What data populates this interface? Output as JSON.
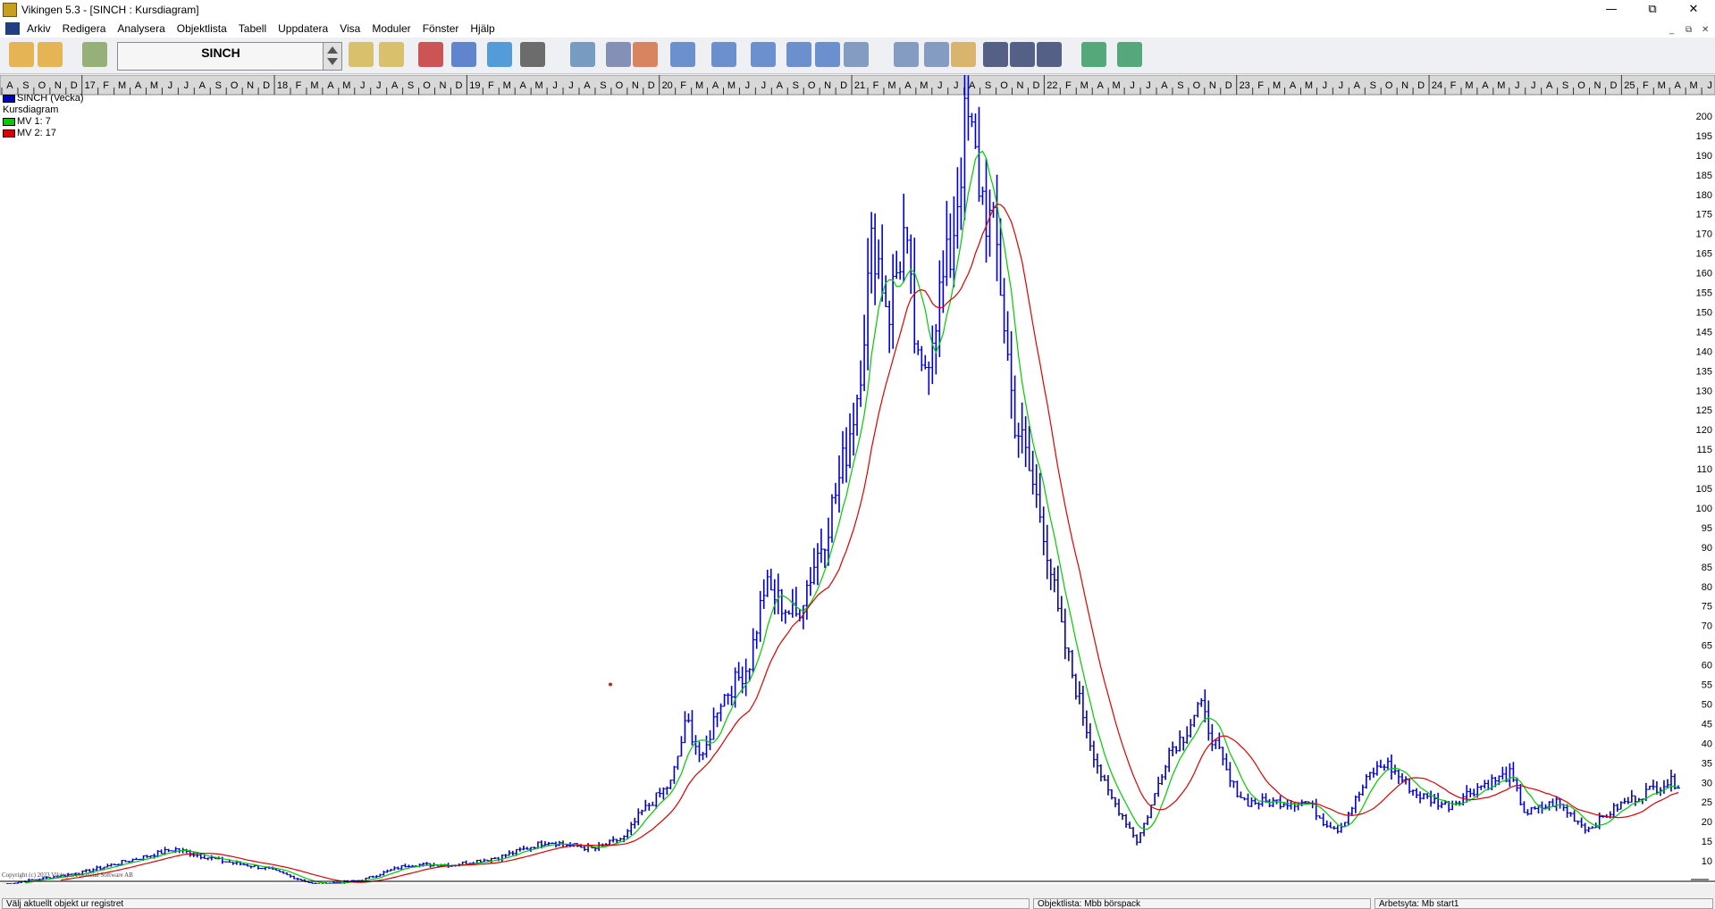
{
  "window": {
    "title": "Vikingen 5.3 - [SINCH : Kursdiagram]",
    "minimize": "—",
    "maximize": "⧉",
    "close": "✕"
  },
  "menu": [
    "Arkiv",
    "Redigera",
    "Analysera",
    "Objektlista",
    "Tabell",
    "Uppdatera",
    "Visa",
    "Moduler",
    "Fönster",
    "Hjälp"
  ],
  "mdi_controls": {
    "minimize": "_",
    "restore": "⧉",
    "close": "✕"
  },
  "toolbar": {
    "symbol": "SINCH",
    "buttons": [
      "open-icon",
      "export-icon",
      "list-icon",
      "edit-list-icon",
      "chart-edit-icon",
      "candles-icon",
      "info-icon",
      "refresh-icon",
      "camera-icon",
      "print-setup-icon",
      "print-icon",
      "palette-icon",
      "window-close-icon",
      "window-back-icon",
      "window-forward-icon",
      "window-stack-icon",
      "window-grid-icon",
      "calendar-day-icon",
      "calendar-week-icon",
      "calendar-month-icon",
      "calendar-edit-icon",
      "candlestick-icon",
      "bars-icon",
      "line-icon",
      "globe-icon",
      "truck-icon"
    ]
  },
  "colors": {
    "accent": "#0000cc",
    "ma1": "#00cc00",
    "ma2": "#dd0000",
    "status_dot": "#cc2020"
  },
  "legend": [
    {
      "label": "SINCH (Vecka)",
      "color": "#0000cc"
    },
    {
      "label": "Kursdiagram",
      "color": ""
    },
    {
      "label": "MV 1: 7",
      "color": "#00cc00"
    },
    {
      "label": "MV 2: 17",
      "color": "#dd0000"
    }
  ],
  "time_axis": {
    "months": [
      "J",
      "F",
      "M",
      "A",
      "M",
      "J",
      "J",
      "A",
      "S",
      "O",
      "N",
      "D"
    ],
    "year_labels": [
      "17",
      "18",
      "19",
      "20",
      "21",
      "22",
      "23",
      "24",
      "25"
    ]
  },
  "chart_data": {
    "type": "ohlc",
    "title": "SINCH (Vecka)",
    "xlabel": "",
    "ylabel": "",
    "x_start": "2016-08",
    "x_end": "2025-07",
    "ylim": [
      5,
      205
    ],
    "y_ticks": [
      10,
      15,
      20,
      25,
      30,
      35,
      40,
      45,
      50,
      55,
      60,
      65,
      70,
      75,
      80,
      85,
      90,
      95,
      100,
      105,
      110,
      115,
      120,
      125,
      130,
      135,
      140,
      145,
      150,
      155,
      160,
      165,
      170,
      175,
      180,
      185,
      190,
      195,
      200
    ],
    "price_anchors": [
      [
        "2016-08",
        4
      ],
      [
        "2017-01",
        7
      ],
      [
        "2017-04",
        10
      ],
      [
        "2017-07",
        13
      ],
      [
        "2017-10",
        10
      ],
      [
        "2018-01",
        8
      ],
      [
        "2018-04",
        4
      ],
      [
        "2018-07",
        5
      ],
      [
        "2018-10",
        9
      ],
      [
        "2019-01",
        9
      ],
      [
        "2019-04",
        11
      ],
      [
        "2019-07",
        15
      ],
      [
        "2019-10",
        13
      ],
      [
        "2019-12",
        16
      ],
      [
        "2020-01",
        22
      ],
      [
        "2020-03",
        30
      ],
      [
        "2020-04",
        46
      ],
      [
        "2020-05",
        35
      ],
      [
        "2020-06",
        50
      ],
      [
        "2020-08",
        60
      ],
      [
        "2020-09",
        80
      ],
      [
        "2020-11",
        72
      ],
      [
        "2021-01",
        95
      ],
      [
        "2021-02",
        110
      ],
      [
        "2021-03",
        130
      ],
      [
        "2021-04",
        170
      ],
      [
        "2021-05",
        150
      ],
      [
        "2021-06",
        170
      ],
      [
        "2021-07",
        130
      ],
      [
        "2021-08",
        150
      ],
      [
        "2021-09",
        165
      ],
      [
        "2021-10",
        200
      ],
      [
        "2021-11",
        180
      ],
      [
        "2021-12",
        165
      ],
      [
        "2022-01",
        125
      ],
      [
        "2022-02",
        110
      ],
      [
        "2022-03",
        95
      ],
      [
        "2022-04",
        70
      ],
      [
        "2022-05",
        55
      ],
      [
        "2022-06",
        40
      ],
      [
        "2022-07",
        28
      ],
      [
        "2022-08",
        22
      ],
      [
        "2022-09",
        15
      ],
      [
        "2022-10",
        25
      ],
      [
        "2022-11",
        38
      ],
      [
        "2022-12",
        42
      ],
      [
        "2023-01",
        50
      ],
      [
        "2023-02",
        40
      ],
      [
        "2023-03",
        30
      ],
      [
        "2023-04",
        25
      ],
      [
        "2023-06",
        25
      ],
      [
        "2023-08",
        25
      ],
      [
        "2023-09",
        20
      ],
      [
        "2023-10",
        18
      ],
      [
        "2023-12",
        32
      ],
      [
        "2024-01",
        35
      ],
      [
        "2024-03",
        27
      ],
      [
        "2024-05",
        24
      ],
      [
        "2024-07",
        29
      ],
      [
        "2024-09",
        32
      ],
      [
        "2024-10",
        22
      ],
      [
        "2024-12",
        25
      ],
      [
        "2025-02",
        18
      ],
      [
        "2025-04",
        24
      ],
      [
        "2025-06",
        28
      ],
      [
        "2025-07",
        30
      ]
    ],
    "moving_averages": [
      {
        "name": "MV 1: 7",
        "period": 7
      },
      {
        "name": "MV 2: 17",
        "period": 17
      }
    ],
    "grid": false,
    "legend_position": "top-left",
    "y_axis_side": "right"
  },
  "copyright": "Copyright (c) 2023 Vikingen Financial Software AB",
  "status": {
    "left": "Välj aktuellt objekt ur registret",
    "middle": "Objektlista: Mbb börspack",
    "right": "Arbetsyta: Mb start1"
  }
}
